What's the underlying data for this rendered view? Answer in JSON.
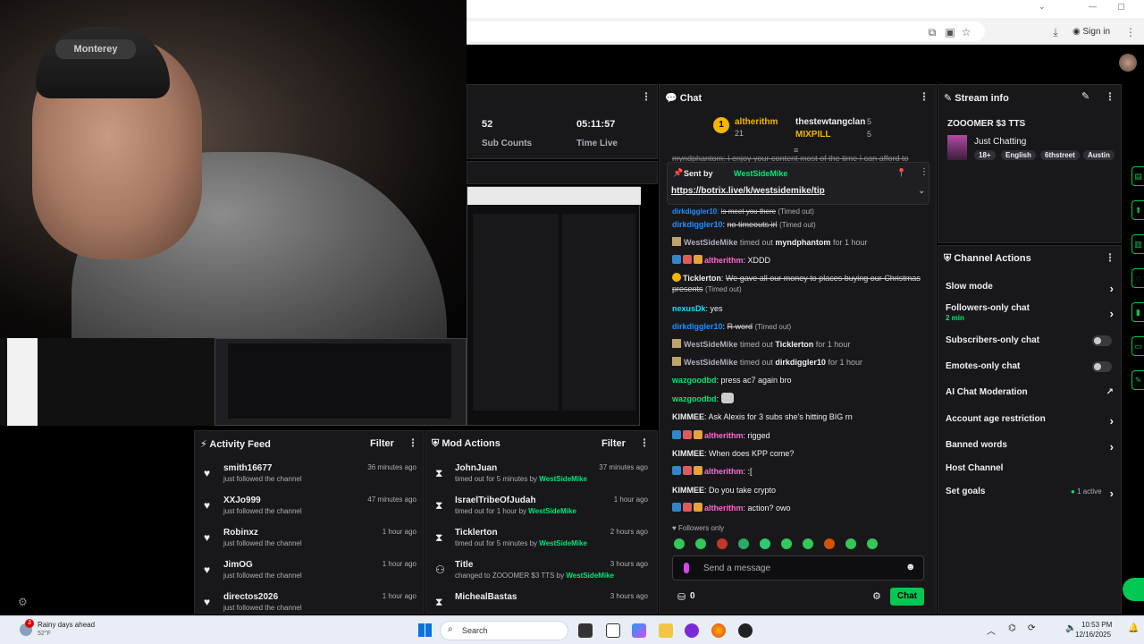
{
  "webcam": {
    "cap_brand": "Monterey"
  },
  "browser": {
    "sign_in_label": "Sign in"
  },
  "stats": {
    "sub_counts_value": "52",
    "sub_counts_label": "Sub Counts",
    "time_live_value": "05:11:57",
    "time_live_label": "Time Live"
  },
  "chat": {
    "title": "Chat",
    "leaderboard": [
      {
        "rank": "1",
        "name": "altherithm",
        "count": "21",
        "color": "#f5b400"
      },
      {
        "name": "thestewtangclan",
        "count": "5",
        "color": "#efeff1"
      },
      {
        "name": "MIXPILL",
        "count": "5",
        "color": "#f5b400"
      }
    ],
    "cutoff_line": "myndphantom: I enjoy your content most of the time I can afford to",
    "pinned": {
      "sent_by_label": "Sent by",
      "sender": "WestSideMike",
      "link": "https://botrix.live/k/westsidemike/tip"
    },
    "messages": [
      {
        "user": "dirkdiggler10",
        "text": "is meet you there",
        "tag": "(Timed out)"
      },
      {
        "user": "dirkdiggler10",
        "text": "no timeouts irl",
        "tag": "(Timed out)"
      },
      {
        "sys_user": "WestSideMike",
        "sys_mid": "timed out",
        "sys_target": "myndphantom",
        "sys_end": "for 1 hour"
      },
      {
        "user": "altherithm",
        "text": "XDDD"
      },
      {
        "user": "Ticklerton",
        "text": "We gave all our money to places buying our Christmas presents",
        "tag": "(Timed out)"
      },
      {
        "user": "nexusDk",
        "text": "yes"
      },
      {
        "user": "dirkdiggler10",
        "text": "R word",
        "tag": "(Timed out)"
      },
      {
        "sys_user": "WestSideMike",
        "sys_mid": "timed out",
        "sys_target": "Ticklerton",
        "sys_end": "for 1 hour"
      },
      {
        "sys_user": "WestSideMike",
        "sys_mid": "timed out",
        "sys_target": "dirkdiggler10",
        "sys_end": "for 1 hour"
      },
      {
        "user": "wazgoodbd",
        "text": "press ac7 again bro"
      },
      {
        "user": "wazgoodbd",
        "text": ""
      },
      {
        "user": "KIMMEE",
        "text": "Ask Alexis for 3 subs she's hitting BIG rn"
      },
      {
        "user": "altherithm",
        "text": "rigged"
      },
      {
        "user": "KIMMEE",
        "text": "When does KPP come?"
      },
      {
        "user": "altherithm",
        "text": ":["
      },
      {
        "user": "KIMMEE",
        "text": "Do you take crypto"
      },
      {
        "user": "altherithm",
        "text": "action? owo"
      }
    ],
    "followers_only_label": "Followers only",
    "send_placeholder": "Send a message",
    "points": "0",
    "chat_button": "Chat"
  },
  "stream_info": {
    "title": "Stream info",
    "stream_title": "ZOOOMER $3 TTS",
    "category": "Just Chatting",
    "tags": [
      "18+",
      "English",
      "6thstreet",
      "Austin"
    ]
  },
  "channel_actions": {
    "title": "Channel Actions",
    "slow_mode": "Slow mode",
    "followers_only": "Followers-only chat",
    "followers_only_value": "2 min",
    "subscribers_only": "Subscribers-only chat",
    "emotes_only": "Emotes-only chat",
    "ai_moderation": "AI Chat Moderation",
    "account_age": "Account age restriction",
    "banned_words": "Banned words",
    "host_channel": "Host Channel",
    "set_goals": "Set goals",
    "set_goals_status": "1 active"
  },
  "activity_feed": {
    "title": "Activity Feed",
    "filter": "Filter",
    "items": [
      {
        "name": "smith16677",
        "sub": "just followed the channel",
        "time": "36 minutes ago"
      },
      {
        "name": "XXJo999",
        "sub": "just followed the channel",
        "time": "47 minutes ago"
      },
      {
        "name": "Robinxz",
        "sub": "just followed the channel",
        "time": "1 hour ago"
      },
      {
        "name": "JimOG",
        "sub": "just followed the channel",
        "time": "1 hour ago"
      },
      {
        "name": "directos2026",
        "sub": "just followed the channel",
        "time": "1 hour ago"
      }
    ]
  },
  "mod_actions": {
    "title": "Mod Actions",
    "filter": "Filter",
    "items": [
      {
        "name": "JohnJuan",
        "pre": "timed out for 5 minutes by",
        "by": "WestSideMike",
        "time": "37 minutes ago"
      },
      {
        "name": "IsraelTribeOfJudah",
        "pre": "timed out for 1 hour by",
        "by": "WestSideMike",
        "time": "1 hour ago"
      },
      {
        "name": "Ticklerton",
        "pre": "timed out for 5 minutes by",
        "by": "WestSideMike",
        "time": "2 hours ago"
      },
      {
        "name": "Title",
        "pre": "changed to ZOOOMER $3 TTS by",
        "by": "WestSideMike",
        "time": "3 hours ago"
      },
      {
        "name": "MichealBastas",
        "pre": "",
        "by": "",
        "time": "3 hours ago"
      }
    ]
  },
  "taskbar": {
    "weather_title": "Rainy days ahead",
    "weather_temp": "52°F",
    "weather_badge": "3",
    "search": "Search",
    "time": "10:53 PM",
    "date": "12/16/2025"
  },
  "colors": {
    "accent": "#00e676",
    "background": "#18181b",
    "text": "#efeff1"
  }
}
